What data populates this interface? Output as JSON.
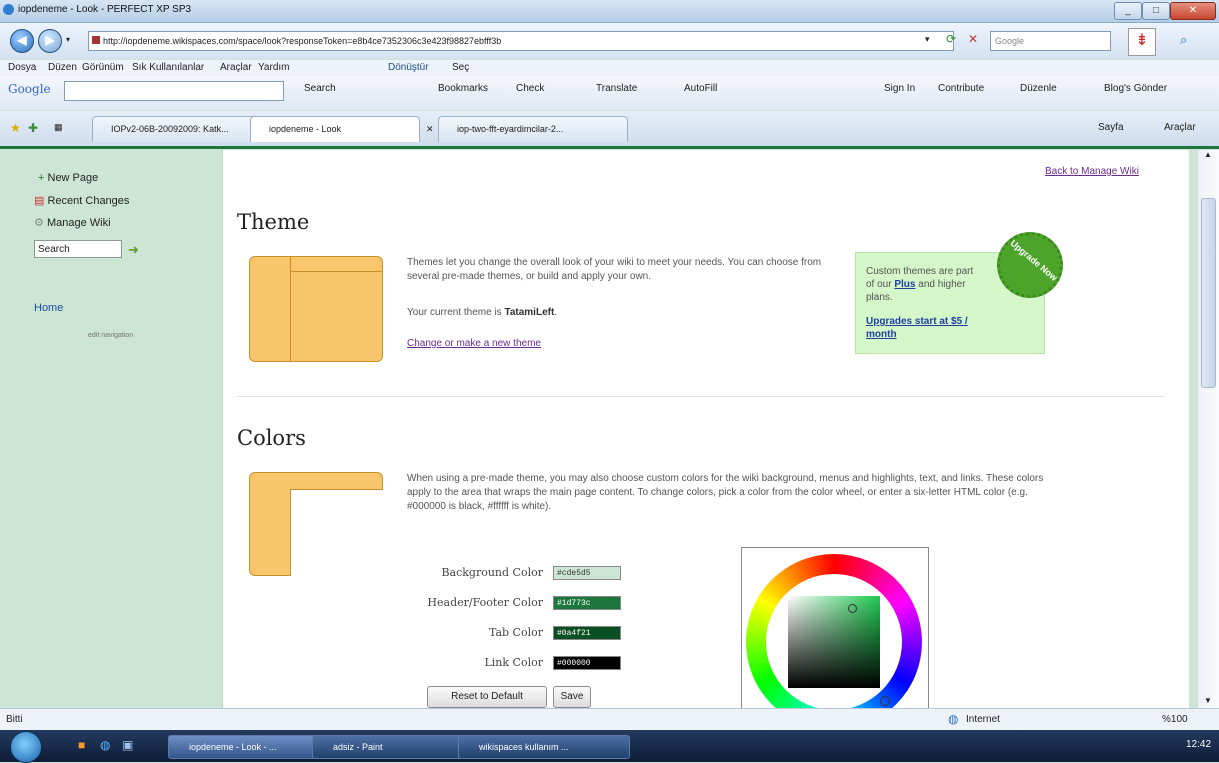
{
  "window": {
    "title": "iopdeneme - Look - PERFECT XP SP3"
  },
  "nav": {
    "url": "http://iopdeneme.wikispaces.com/space/look?responseToken=e8b4ce7352306c3e423f98827ebfff3b",
    "search_placeholder": "Google"
  },
  "menus": [
    "Dosya",
    "Düzen",
    "Görünüm",
    "Sık Kullanılanlar",
    "Araçlar",
    "Yardım"
  ],
  "menu_extra": [
    "Dönüştür",
    "Seç"
  ],
  "google_toolbar": {
    "logo": "Google",
    "items": [
      "Search",
      "Bookmarks",
      "Check",
      "Translate",
      "AutoFill"
    ],
    "right_items": [
      "Sign In",
      "Contribute",
      "Düzenle",
      "Blog's Gönder"
    ]
  },
  "tabs": [
    {
      "label": "IOPv2-06B-20092009: Katk..."
    },
    {
      "label": "iopdeneme - Look"
    },
    {
      "label": "iop-two-fft-eyardimcilar-2..."
    }
  ],
  "tab_tools": [
    "Sayfa",
    "Araçlar"
  ],
  "sidebar": {
    "items": [
      {
        "label": "New Page"
      },
      {
        "label": "Recent Changes"
      },
      {
        "label": "Manage Wiki"
      }
    ],
    "search_value": "Search",
    "home": "Home",
    "edit_nav": "edit navigation"
  },
  "main": {
    "back_link": "Back to Manage Wiki",
    "theme": {
      "heading": "Theme",
      "desc": "Themes let you change the overall look of your wiki to meet your needs. You can choose from several pre-made themes, or build and apply your own.",
      "current_prefix": "Your current theme is ",
      "current_name": "TatamiLeft",
      "current_suffix": ".",
      "change_link": "Change or make a new theme"
    },
    "upgrade": {
      "badge": "Upgrade Now",
      "text_before": "Custom themes are part of our ",
      "plus": "Plus",
      "text_after": " and higher plans.",
      "link": "Upgrades start at $5 / month"
    },
    "colors": {
      "heading": "Colors",
      "desc": "When using a pre-made theme, you may also choose custom colors for the wiki background, menus and highlights, text, and links. These colors apply to the area that wraps the main page content. To change colors, pick a color from the color wheel, or enter a six-letter HTML color (e.g. #000000 is black, #ffffff is white).",
      "fields": [
        {
          "label": "Background Color",
          "value": "#cde5d5",
          "color": "#cde5d5"
        },
        {
          "label": "Header/Footer Color",
          "value": "#1d773c",
          "color": "#1d773c"
        },
        {
          "label": "Tab Color",
          "value": "#0a4f21",
          "color": "#0a4f21"
        },
        {
          "label": "Link Color",
          "value": "#000000",
          "color": "#000000"
        }
      ],
      "reset_label": "Reset to Default",
      "save_label": "Save"
    }
  },
  "status": {
    "left": "Bitti",
    "zone": "Internet",
    "zoom": "%100"
  },
  "taskbar": {
    "buttons": [
      "iopdeneme - Look - ...",
      "adsiz - Paint",
      "wikispaces kullanım ..."
    ],
    "clock": "12:42"
  }
}
